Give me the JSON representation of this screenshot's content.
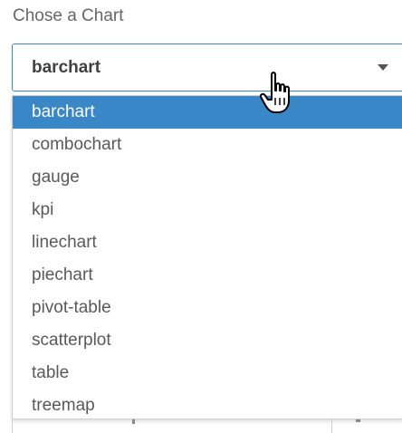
{
  "label": "Chose a Chart",
  "select": {
    "value": "barchart"
  },
  "options": [
    "barchart",
    "combochart",
    "gauge",
    "kpi",
    "linechart",
    "piechart",
    "pivot-table",
    "scatterplot",
    "table",
    "treemap"
  ],
  "selected_index": 0,
  "icons": {
    "caret": "chevron-down-icon",
    "cursor": "hand-pointer-icon"
  },
  "colors": {
    "accent": "#3a87c8",
    "text": "#595959"
  }
}
